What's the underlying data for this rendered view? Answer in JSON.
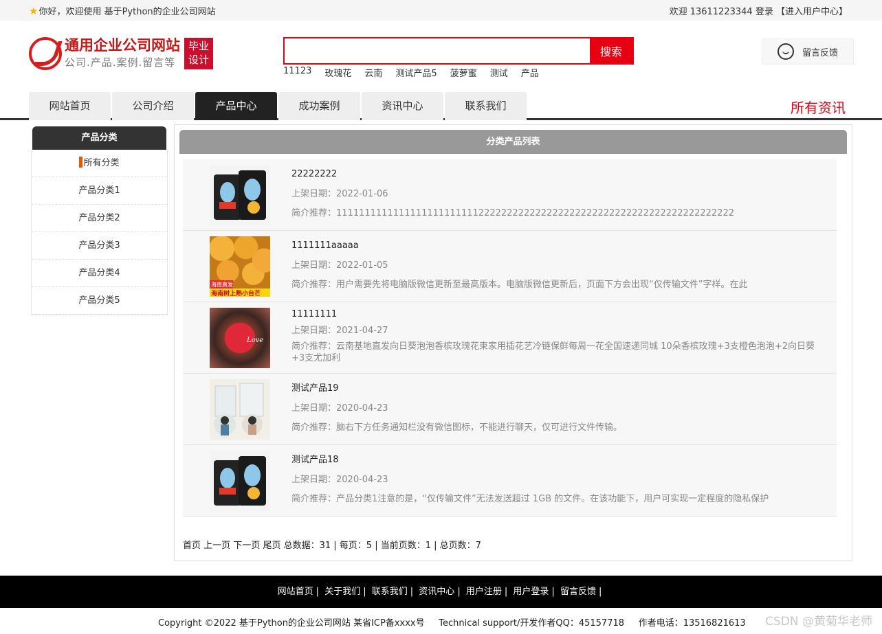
{
  "topbar": {
    "greeting": "你好，欢迎使用 基于Python的企业公司网站",
    "welcome": "欢迎 13611223344",
    "login": "登录",
    "user_center": "【进入用户中心】"
  },
  "logo": {
    "title": "通用企业公司网站",
    "subtitle": "公司.产品.案例.留言等",
    "badge_line1": "毕业",
    "badge_line2": "设计"
  },
  "search": {
    "value": "",
    "placeholder": "",
    "button": "搜索",
    "hot_words": [
      "11123",
      "玫瑰花",
      "云南",
      "测试产品5",
      "菠萝蜜",
      "测试",
      "产品"
    ]
  },
  "feedback": {
    "label": "留言反馈"
  },
  "nav": {
    "tabs": [
      "网站首页",
      "公司介绍",
      "产品中心",
      "成功案例",
      "资讯中心",
      "联系我们"
    ],
    "active_index": 2,
    "all_news": "所有资讯"
  },
  "sidebar": {
    "title": "产品分类",
    "items": [
      "所有分类",
      "产品分类1",
      "产品分类2",
      "产品分类3",
      "产品分类4",
      "产品分类5"
    ]
  },
  "main": {
    "title": "分类产品列表",
    "date_label": "上架日期：",
    "desc_label": "简介推荐：",
    "products": [
      {
        "name": "22222222",
        "date": "2022-01-06",
        "desc": "1111111111111111111111111222222222222222222222222222222222222222222222"
      },
      {
        "name": "1111111aaaaa",
        "date": "2022-01-05",
        "desc": "用户需要先将电脑版微信更新至最高版本。电脑版微信更新后，页面下方会出现“仅传输文件”字样。在此",
        "img_tag": "海南直发",
        "img_caption": "海南树上熟小台芒"
      },
      {
        "name": "11111111",
        "date": "2021-04-27",
        "desc": "云南基地直发向日葵泡泡香槟玫瑰花束家用插花艺冷链保鲜每周一花全国速递同城 10朵香槟玫瑰+3支橙色泡泡+2向日葵+3支尤加利",
        "img_tag": "Love"
      },
      {
        "name": "测试产品19",
        "date": "2020-04-23",
        "desc": "脑右下方任务通知栏没有微信图标，不能进行聊天，仅可进行文件传输。"
      },
      {
        "name": "测试产品18",
        "date": "2020-04-23",
        "desc": "产品分类1注意的是，“仅传输文件”无法发送超过 1GB 的文件。在该功能下，用户可实现一定程度的隐私保护"
      }
    ]
  },
  "pager": {
    "first": "首页",
    "prev": "上一页",
    "next": "下一页",
    "last": "尾页",
    "summary": "总数据：31 | 每页：5 | 当前页数：1 | 总页数：7"
  },
  "footer": {
    "links": [
      "网站首页",
      "关于我们",
      "联系我们",
      "资讯中心",
      "用户注册",
      "用户登录",
      "留言反馈"
    ],
    "copyright": "Copyright ©2022 基于Python的企业公司网站 某省ICP备xxxx号",
    "support": "Technical support/开发作者QQ：45157718",
    "phone": "作者电话：13516821613",
    "watermark": "CSDN @黄菊华老师"
  },
  "colors": {
    "accent": "#e60012",
    "nav_active": "#222222",
    "sidebar_mark": "#e55a00"
  }
}
